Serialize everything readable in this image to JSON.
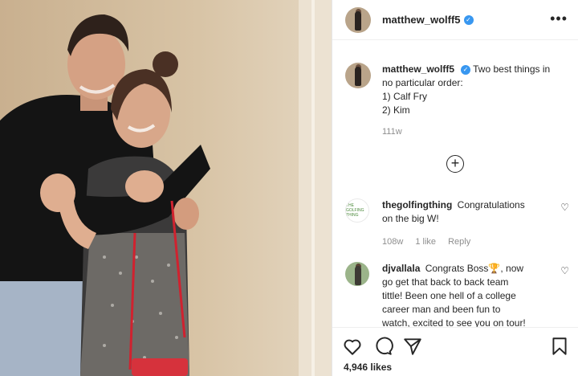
{
  "post": {
    "username": "matthew_wolff5",
    "verified_icon": "verified-badge-icon",
    "caption_lines": [
      "Two best things in",
      "no particular order:",
      "1) Calf Fry",
      "2) Kim"
    ],
    "caption_time": "111w"
  },
  "comments": [
    {
      "username": "thegolfingthing",
      "text_lines": [
        "Congratulations",
        "on the big W!"
      ],
      "time": "108w",
      "likes": "1 like",
      "reply": "Reply",
      "avatar_text": "THE GOLFING THING"
    },
    {
      "username": "djvallala",
      "text_lines": [
        "Congrats Boss🏆, now",
        "go get that back to back team",
        "tittle! Been one hell of a college",
        "career man and been fun to",
        "watch, excited to see you on tour!"
      ]
    }
  ],
  "footer": {
    "likes_count": "4,946 likes"
  },
  "colors": {
    "verified": "#3897f0",
    "text": "#262626",
    "muted": "#8e8e8e"
  }
}
